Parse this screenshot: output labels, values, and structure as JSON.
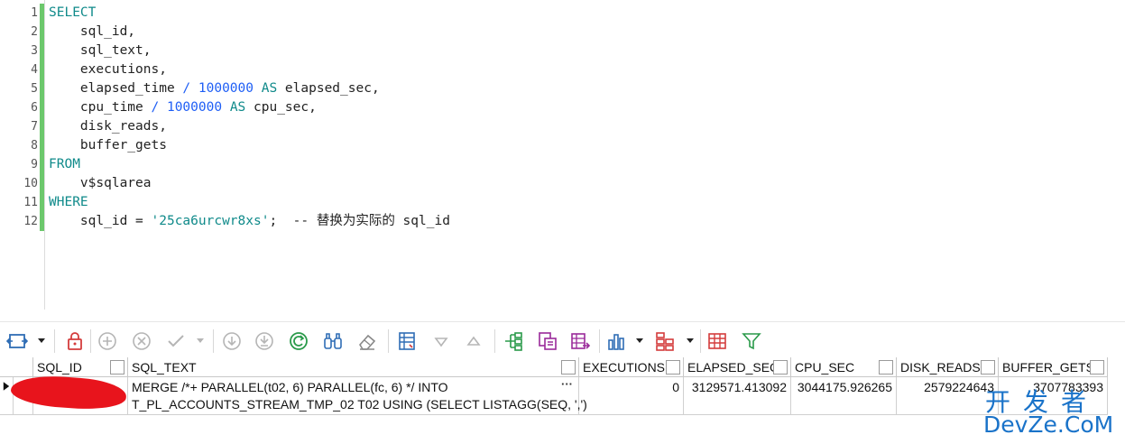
{
  "editor": {
    "line_numbers": [
      "1",
      "2",
      "3",
      "4",
      "5",
      "6",
      "7",
      "8",
      "9",
      "10",
      "11",
      "12"
    ],
    "lines": [
      [
        {
          "t": "kw",
          "v": "SELECT"
        }
      ],
      [
        {
          "t": "tx",
          "v": "    sql_id,"
        }
      ],
      [
        {
          "t": "tx",
          "v": "    sql_text,"
        }
      ],
      [
        {
          "t": "tx",
          "v": "    executions,"
        }
      ],
      [
        {
          "t": "tx",
          "v": "    elapsed_time "
        },
        {
          "t": "op",
          "v": "/"
        },
        {
          "t": "tx",
          "v": " "
        },
        {
          "t": "num",
          "v": "1000000"
        },
        {
          "t": "tx",
          "v": " "
        },
        {
          "t": "kw",
          "v": "AS"
        },
        {
          "t": "tx",
          "v": " elapsed_sec,"
        }
      ],
      [
        {
          "t": "tx",
          "v": "    cpu_time "
        },
        {
          "t": "op",
          "v": "/"
        },
        {
          "t": "tx",
          "v": " "
        },
        {
          "t": "num",
          "v": "1000000"
        },
        {
          "t": "tx",
          "v": " "
        },
        {
          "t": "kw",
          "v": "AS"
        },
        {
          "t": "tx",
          "v": " cpu_sec,"
        }
      ],
      [
        {
          "t": "tx",
          "v": "    disk_reads,"
        }
      ],
      [
        {
          "t": "tx",
          "v": "    buffer_gets"
        }
      ],
      [
        {
          "t": "kw",
          "v": "FROM"
        }
      ],
      [
        {
          "t": "tx",
          "v": "    v$sqlarea"
        }
      ],
      [
        {
          "t": "kw",
          "v": "WHERE"
        }
      ],
      [
        {
          "t": "tx",
          "v": "    sql_id = "
        },
        {
          "t": "str",
          "v": "'25ca6urcwr8xs'"
        },
        {
          "t": "tx",
          "v": ";  -- 替换为实际的 sql_id"
        }
      ]
    ]
  },
  "grid": {
    "columns": [
      "SQL_ID",
      "SQL_TEXT",
      "EXECUTIONS",
      "ELAPSED_SEC",
      "CPU_SEC",
      "DISK_READS",
      "BUFFER_GETS"
    ],
    "row": {
      "sql_id": "",
      "sql_text_line1": "MERGE /*+ PARALLEL(t02, 6) PARALLEL(fc, 6) */ INTO",
      "sql_text_line2": "T_PL_ACCOUNTS_STREAM_TMP_02 T02 USING (SELECT LISTAGG(SEQ, ',')",
      "sql_text_more": "···",
      "executions": "0",
      "elapsed_sec": "3129571.413092",
      "cpu_sec": "3044175.926265",
      "disk_reads": "2579224643",
      "buffer_gets": "3707783393"
    }
  },
  "watermark": {
    "cn": "开发者",
    "en": "DevZe.CoM"
  },
  "colors": {
    "keyword": "#0f8a8a",
    "number": "#1e5ef5",
    "string": "#0f8a8a",
    "gutter_mark": "#6cc86c",
    "redaction": "#e8141c",
    "watermark": "#1a73c9"
  }
}
